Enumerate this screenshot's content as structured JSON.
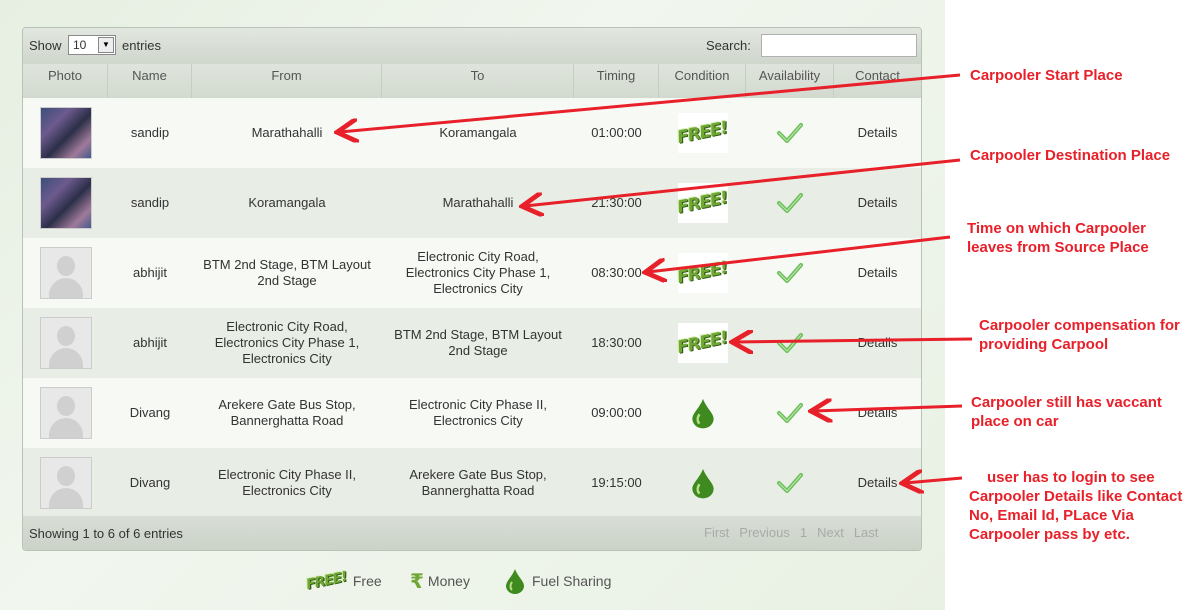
{
  "controls": {
    "show_label": "Show",
    "page_size": "10",
    "entries_label": "entries",
    "search_label": "Search:",
    "search_value": ""
  },
  "columns": [
    "Photo",
    "Name",
    "From",
    "To",
    "Timing",
    "Condition",
    "Availability",
    "Contact"
  ],
  "rows": [
    {
      "photo": "group-photo",
      "name": "sandip",
      "from": "Marathahalli",
      "to": "Koramangala",
      "timing": "01:00:00",
      "condition": "free",
      "availability": "check-icon",
      "contact": "Details"
    },
    {
      "photo": "group-photo",
      "name": "sandip",
      "from": "Koramangala",
      "to": "Marathahalli",
      "timing": "21:30:00",
      "condition": "free",
      "availability": "check-icon",
      "contact": "Details"
    },
    {
      "photo": "default-avatar",
      "name": "abhijit",
      "from": "BTM 2nd Stage, BTM Layout 2nd Stage",
      "to": "Electronic City Road, Electronics City Phase 1, Electronics City",
      "timing": "08:30:00",
      "condition": "free",
      "availability": "check-icon",
      "contact": "Details"
    },
    {
      "photo": "default-avatar",
      "name": "abhijit",
      "from": "Electronic City Road, Electronics City Phase 1, Electronics City",
      "to": "BTM 2nd Stage, BTM Layout 2nd Stage",
      "timing": "18:30:00",
      "condition": "free",
      "availability": "check-icon",
      "contact": "Details"
    },
    {
      "photo": "default-avatar",
      "name": "Divang",
      "from": "Arekere Gate Bus Stop, Bannerghatta Road",
      "to": "Electronic City Phase II, Electronics City",
      "timing": "09:00:00",
      "condition": "fuel-sharing",
      "availability": "check-icon",
      "contact": "Details"
    },
    {
      "photo": "default-avatar",
      "name": "Divang",
      "from": "Electronic City Phase II, Electronics City",
      "to": "Arekere Gate Bus Stop, Bannerghatta Road",
      "timing": "19:15:00",
      "condition": "fuel-sharing",
      "availability": "check-icon",
      "contact": "Details"
    }
  ],
  "footer": {
    "info": "Showing 1 to 6 of 6 entries",
    "pager": [
      "First",
      "Previous",
      "1",
      "Next",
      "Last"
    ]
  },
  "free_badge_text": "FREE!",
  "legend": [
    {
      "icon": "free-icon",
      "label": "Free"
    },
    {
      "icon": "rupee-icon",
      "label": "Money"
    },
    {
      "icon": "fuel-drop-icon",
      "label": "Fuel Sharing"
    }
  ],
  "annotations": [
    {
      "text": "Carpooler Start Place"
    },
    {
      "text": "Carpooler Destination Place"
    },
    {
      "text": "Time on which Carpooler leaves from Source Place"
    },
    {
      "text": "Carpooler compensation for providing Carpool"
    },
    {
      "text": "Carpooler still has vaccant place on car"
    },
    {
      "text": "user has to login to see Carpooler Details like Contact No, Email Id, PLace Via Carpooler pass by etc."
    }
  ],
  "colors": {
    "annotation": "#e8202a",
    "check": "#6cbf5a",
    "free_badge": "#6fa634",
    "drop": "#3f8a1e"
  }
}
